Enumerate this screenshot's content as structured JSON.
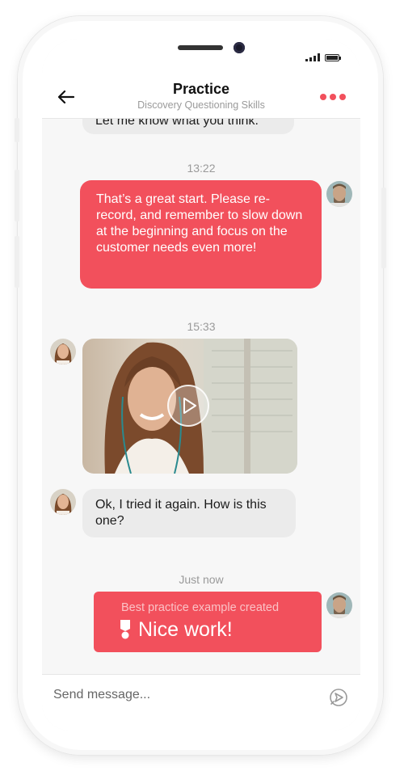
{
  "header": {
    "title": "Practice",
    "subtitle": "Discovery Questioning Skills"
  },
  "messages": {
    "partial": "Let me know what you think.",
    "time1": "13:22",
    "coach_reply": "That’s a great start. Please re-record, and remember to slow down at the beginning and focus on the customer needs even more!",
    "time2": "15:33",
    "user_text": "Ok, I tried it again. How is this one?",
    "time3": "Just now",
    "badge_caption": "Best practice example created",
    "badge_title": "Nice work!"
  },
  "composer": {
    "placeholder": "Send message..."
  },
  "colors": {
    "accent": "#f2505c",
    "bubble_grey": "#ebebeb",
    "background": "#f7f7f7"
  },
  "icons": [
    "back-arrow-icon",
    "more-dots-icon",
    "play-icon",
    "medal-icon",
    "send-icon",
    "signal-icon",
    "battery-icon"
  ]
}
